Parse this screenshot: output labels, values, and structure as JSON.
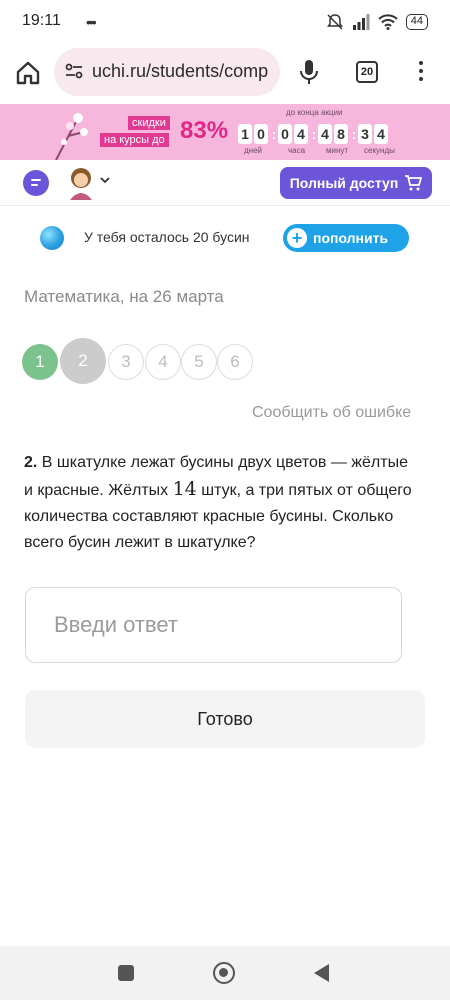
{
  "status_bar": {
    "time": "19:11",
    "battery": "44"
  },
  "browser": {
    "url": "uchi.ru/students/comp",
    "tab_count": "20"
  },
  "promo": {
    "tag_line1": "скидки",
    "tag_line2": "на курсы до",
    "percent": "83%",
    "deadline_label": "до конца акции",
    "timer": {
      "days": [
        "1",
        "0"
      ],
      "hours": [
        "0",
        "4"
      ],
      "minutes": [
        "4",
        "8"
      ],
      "seconds": [
        "3",
        "4"
      ]
    },
    "labels": {
      "days": "дней",
      "hours": "часа",
      "minutes": "минут",
      "seconds": "секунды"
    }
  },
  "header": {
    "full_access_label": "Полный доступ"
  },
  "beads": {
    "text": "У тебя осталось 20 бусин",
    "refill_label": "пополнить"
  },
  "subject": "Математика, на 26 марта",
  "steps": [
    "1",
    "2",
    "3",
    "4",
    "5",
    "6"
  ],
  "report_label": "Сообщить об ошибке",
  "question": {
    "number": "2.",
    "text_before": " В шкатулке лежат бусины двух цветов — жёлтые и красные. Жёлтых ",
    "number_value": "14",
    "text_after": " штук, а три пятых от общего количества составляют красные бусины. Сколько всего бусин лежит в шкатулке?"
  },
  "answer": {
    "placeholder": "Введи ответ",
    "value": ""
  },
  "submit_label": "Готово",
  "colors": {
    "accent": "#6c55d9",
    "refill": "#1fa3e8",
    "step_done": "#7cc28d",
    "banner": "#f7b6db",
    "promo": "#e0278a"
  }
}
